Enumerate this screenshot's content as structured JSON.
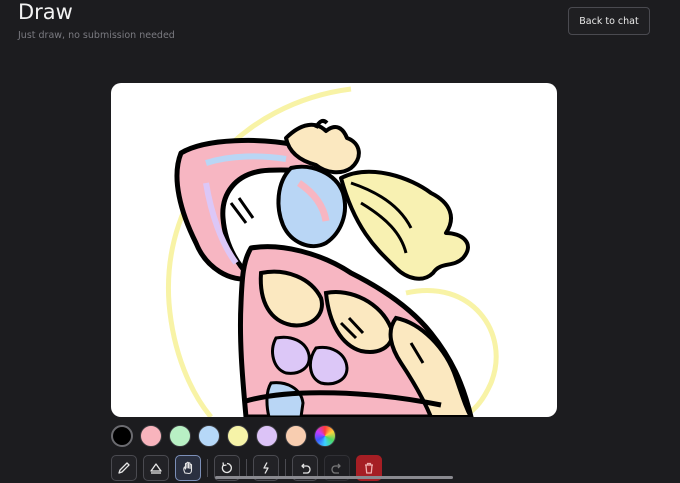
{
  "header": {
    "title": "Draw",
    "subtitle": "Just draw, no submission needed",
    "back_label": "Back to chat"
  },
  "colors": {
    "background": "#1c1c1f",
    "canvas": "#ffffff",
    "ink": "#000000",
    "pink": "#f7b6c2",
    "blue": "#b9d6f5",
    "yellow": "#f8f3a6",
    "cream": "#fbe8c0",
    "lavender": "#dcc7f7",
    "delete": "#a51e24"
  },
  "palette": [
    {
      "name": "black",
      "hex": "#000000",
      "selected": true
    },
    {
      "name": "pink",
      "hex": "#f8b4bd",
      "selected": false
    },
    {
      "name": "mint",
      "hex": "#b8f0c4",
      "selected": false
    },
    {
      "name": "sky",
      "hex": "#b6d8f8",
      "selected": false
    },
    {
      "name": "yellow",
      "hex": "#f6f3a8",
      "selected": false
    },
    {
      "name": "lavender",
      "hex": "#dcc3f7",
      "selected": false
    },
    {
      "name": "peach",
      "hex": "#f8cdb0",
      "selected": false
    },
    {
      "name": "custom",
      "hex": "rainbow",
      "selected": false
    }
  ],
  "tools": {
    "active": "hand",
    "items": [
      "pencil-icon",
      "eraser-icon",
      "hand-icon",
      "rotate-icon",
      "lightning-icon",
      "undo-icon",
      "redo-icon",
      "trash-icon"
    ]
  }
}
